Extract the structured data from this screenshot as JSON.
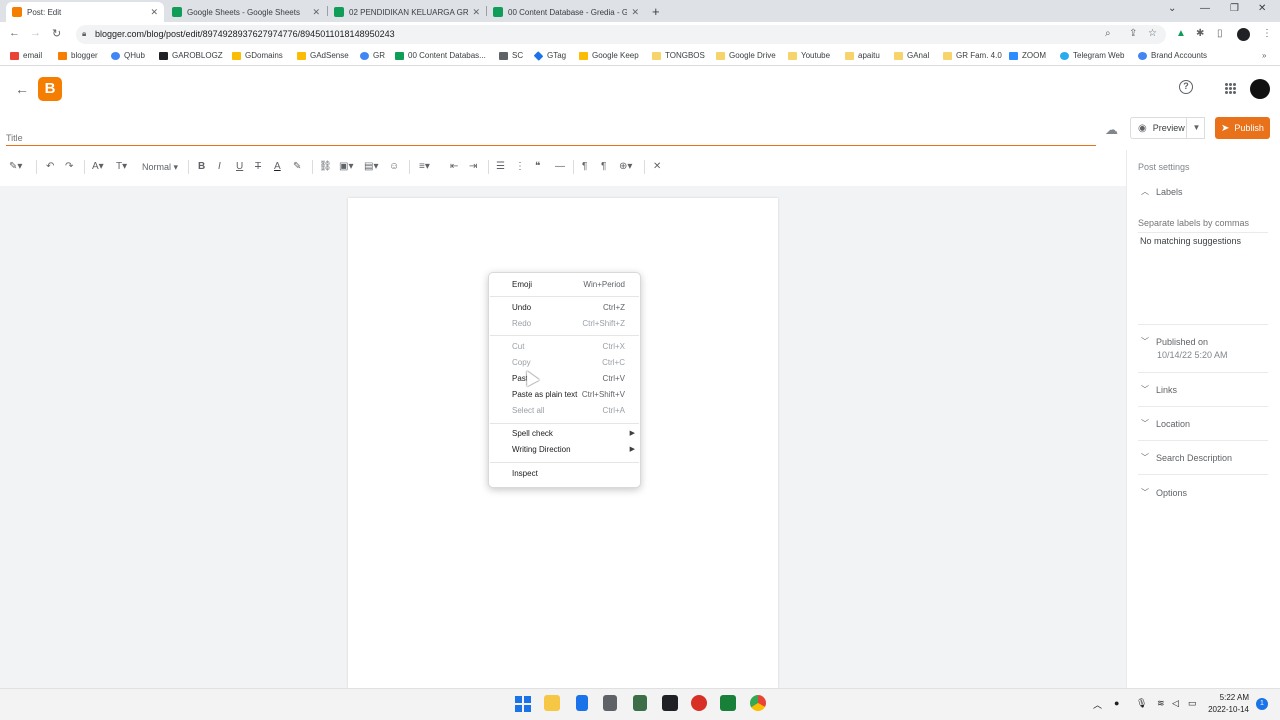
{
  "browser": {
    "tabs": [
      {
        "title": "Post: Edit",
        "active": true,
        "favicon_color": "#f57d00"
      },
      {
        "title": "Google Sheets - Google Sheets",
        "active": false,
        "favicon_color": "#0f9d58"
      },
      {
        "title": "02 PENDIDIKAN KELUARGA GRY",
        "active": false,
        "favicon_color": "#0f9d58"
      },
      {
        "title": "00 Content Database - Gredia - G",
        "active": false,
        "favicon_color": "#0f9d58"
      }
    ],
    "url": "blogger.com/blog/post/edit/8974928937627974776/8945011018148950243",
    "bookmarks": [
      {
        "label": "email",
        "icon": "gmail-icon",
        "color": "#ea4335"
      },
      {
        "label": "blogger",
        "icon": "blogger-icon",
        "color": "#f57d00"
      },
      {
        "label": "QHub",
        "icon": "google-icon",
        "color": "#4285f4"
      },
      {
        "label": "GAROBLOGZ",
        "icon": "page-icon",
        "color": "#202124"
      },
      {
        "label": "GDomains",
        "icon": "domains-icon",
        "color": "#fbbc04"
      },
      {
        "label": "GAdSense",
        "icon": "adsense-icon",
        "color": "#fbbc04"
      },
      {
        "label": "GR",
        "icon": "google-icon",
        "color": "#4285f4"
      },
      {
        "label": "00 Content Databas...",
        "icon": "sheets-icon",
        "color": "#0f9d58"
      },
      {
        "label": "SC",
        "icon": "search-console-icon",
        "color": "#5f6368"
      },
      {
        "label": "GTag",
        "icon": "gtag-icon",
        "color": "#1a73e8"
      },
      {
        "label": "Google Keep",
        "icon": "keep-icon",
        "color": "#fbbc04"
      },
      {
        "label": "TONGBOS",
        "icon": "folder-icon",
        "color": "#f6d36b"
      },
      {
        "label": "Google Drive",
        "icon": "folder-icon",
        "color": "#f6d36b"
      },
      {
        "label": "Youtube",
        "icon": "folder-icon",
        "color": "#f6d36b"
      },
      {
        "label": "apaitu",
        "icon": "folder-icon",
        "color": "#f6d36b"
      },
      {
        "label": "GAnal",
        "icon": "folder-icon",
        "color": "#f6d36b"
      },
      {
        "label": "GR Fam. 4.0",
        "icon": "folder-icon",
        "color": "#f6d36b"
      },
      {
        "label": "ZOOM",
        "icon": "zoom-icon",
        "color": "#2d8cff"
      },
      {
        "label": "Telegram Web",
        "icon": "telegram-icon",
        "color": "#2aabee"
      },
      {
        "label": "Brand Accounts",
        "icon": "google-icon",
        "color": "#4285f4"
      }
    ]
  },
  "editor": {
    "title_placeholder": "Title",
    "preview_label": "Preview",
    "publish_label": "Publish",
    "font_style": "Normal",
    "accent_color": "#e8711a"
  },
  "sidebar": {
    "post_settings": "Post settings",
    "labels_section": "Labels",
    "labels_placeholder": "Separate labels by commas",
    "labels_suggestion": "No matching suggestions",
    "published_label": "Published on",
    "published_date": "10/14/22 5:20 AM",
    "links_section": "Links",
    "location_section": "Location",
    "search_description_section": "Search Description",
    "options_section": "Options"
  },
  "context_menu": {
    "emoji": {
      "label": "Emoji",
      "shortcut": "Win+Period"
    },
    "undo": {
      "label": "Undo",
      "shortcut": "Ctrl+Z"
    },
    "redo": {
      "label": "Redo",
      "shortcut": "Ctrl+Shift+Z"
    },
    "cut": {
      "label": "Cut",
      "shortcut": "Ctrl+X"
    },
    "copy": {
      "label": "Copy",
      "shortcut": "Ctrl+C"
    },
    "paste": {
      "label": "Paste",
      "shortcut": "Ctrl+V"
    },
    "paste_plain": {
      "label": "Paste as plain text",
      "shortcut": "Ctrl+Shift+V"
    },
    "select_all": {
      "label": "Select all",
      "shortcut": "Ctrl+A"
    },
    "spell_check": {
      "label": "Spell check"
    },
    "writing_direction": {
      "label": "Writing Direction"
    },
    "inspect": {
      "label": "Inspect"
    }
  },
  "taskbar": {
    "time": "5:22 AM",
    "date": "2022-10-14",
    "notifications": "1"
  }
}
